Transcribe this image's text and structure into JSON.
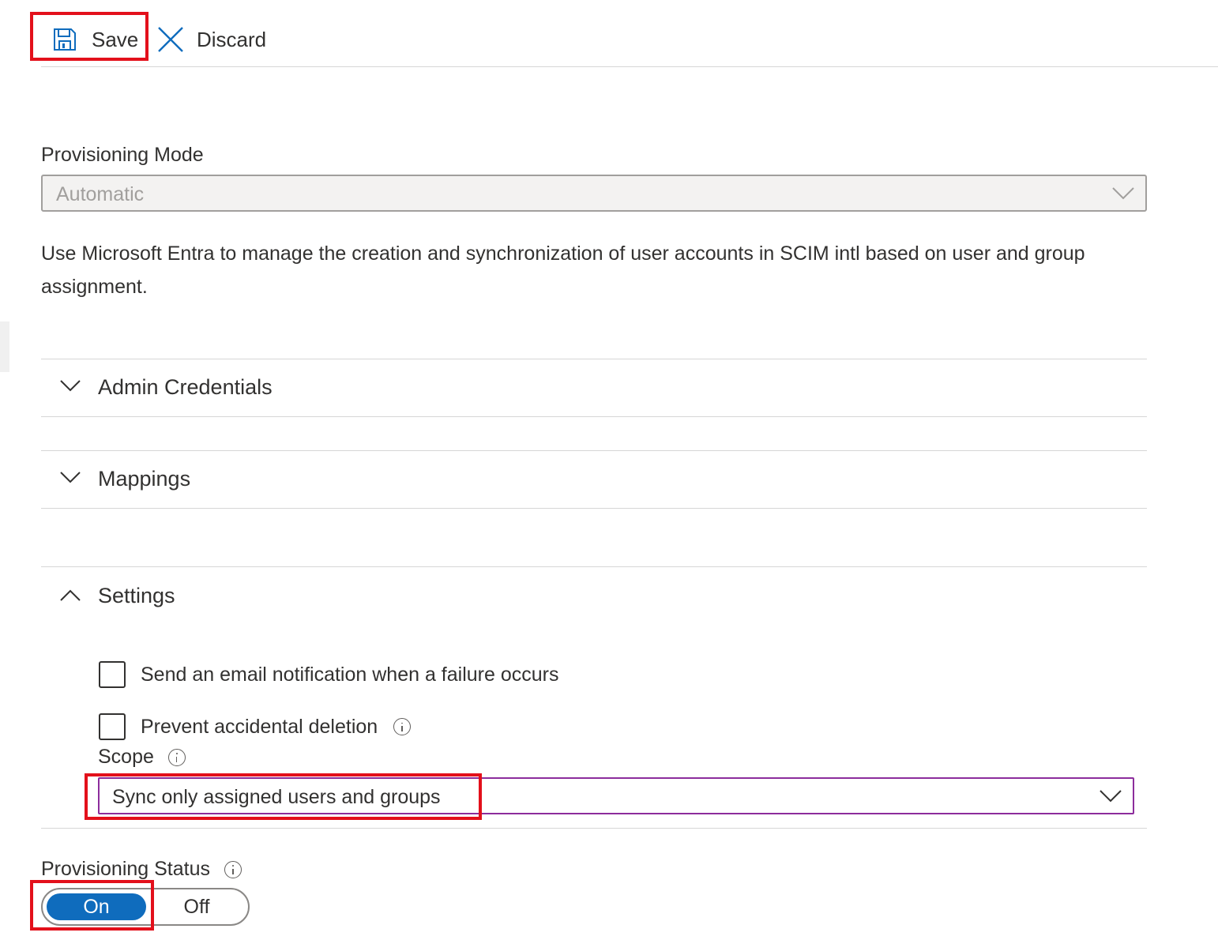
{
  "toolbar": {
    "save_label": "Save",
    "discard_label": "Discard"
  },
  "provisioning_mode": {
    "label": "Provisioning Mode",
    "value": "Automatic"
  },
  "description": "Use Microsoft Entra to manage the creation and synchronization of user accounts in SCIM intl based on user and group assignment.",
  "sections": {
    "admin_credentials": "Admin Credentials",
    "mappings": "Mappings",
    "settings": "Settings"
  },
  "settings": {
    "email_notification_label": "Send an email notification when a failure occurs",
    "email_notification_checked": false,
    "prevent_deletion_label": "Prevent accidental deletion",
    "prevent_deletion_checked": false,
    "scope_label": "Scope",
    "scope_value": "Sync only assigned users and groups"
  },
  "provisioning_status": {
    "label": "Provisioning Status",
    "on_label": "On",
    "off_label": "Off",
    "selected": "On"
  },
  "colors": {
    "accent": "#0f6cbd",
    "highlight": "#e3101b",
    "scope_border": "#8c2d9c"
  }
}
